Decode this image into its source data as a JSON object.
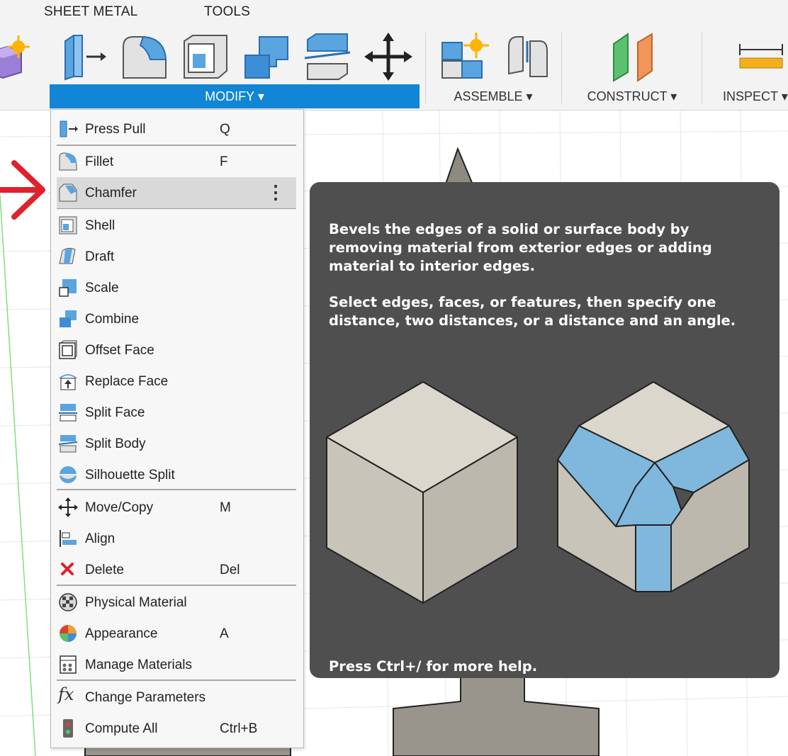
{
  "toolbar": {
    "tabs": [
      {
        "label": "SHEET METAL"
      },
      {
        "label": "TOOLS"
      }
    ],
    "sections": {
      "modify": "MODIFY ▾",
      "assemble": "ASSEMBLE ▾",
      "construct": "CONSTRUCT ▾",
      "inspect": "INSPECT ▾"
    },
    "icons": [
      "create-form-icon",
      "press-pull-icon",
      "fillet-icon",
      "shell-icon",
      "combine-icon",
      "split-body-icon",
      "move-icon",
      "new-component-icon",
      "joint-icon",
      "offset-plane-icon",
      "measure-icon"
    ],
    "accent": "#1185d6"
  },
  "menu": {
    "items": [
      {
        "label": "Press Pull",
        "shortcut": "Q",
        "icon": "press-pull-icon"
      },
      {
        "label": "Fillet",
        "shortcut": "F",
        "icon": "fillet-icon"
      },
      {
        "label": "Chamfer",
        "shortcut": "",
        "icon": "chamfer-icon",
        "highlighted": true
      },
      {
        "label": "Shell",
        "shortcut": "",
        "icon": "shell-icon"
      },
      {
        "label": "Draft",
        "shortcut": "",
        "icon": "draft-icon"
      },
      {
        "label": "Scale",
        "shortcut": "",
        "icon": "scale-icon"
      },
      {
        "label": "Combine",
        "shortcut": "",
        "icon": "combine-icon"
      },
      {
        "label": "Offset Face",
        "shortcut": "",
        "icon": "offset-face-icon"
      },
      {
        "label": "Replace Face",
        "shortcut": "",
        "icon": "replace-face-icon"
      },
      {
        "label": "Split Face",
        "shortcut": "",
        "icon": "split-face-icon"
      },
      {
        "label": "Split Body",
        "shortcut": "",
        "icon": "split-body-icon"
      },
      {
        "label": "Silhouette Split",
        "shortcut": "",
        "icon": "silhouette-split-icon"
      },
      {
        "label": "Move/Copy",
        "shortcut": "M",
        "icon": "move-copy-icon"
      },
      {
        "label": "Align",
        "shortcut": "",
        "icon": "align-icon"
      },
      {
        "label": "Delete",
        "shortcut": "Del",
        "icon": "delete-icon"
      },
      {
        "label": "Physical Material",
        "shortcut": "",
        "icon": "physical-material-icon"
      },
      {
        "label": "Appearance",
        "shortcut": "A",
        "icon": "appearance-icon"
      },
      {
        "label": "Manage Materials",
        "shortcut": "",
        "icon": "manage-materials-icon"
      },
      {
        "label": "Change Parameters",
        "shortcut": "",
        "icon": "change-parameters-icon"
      },
      {
        "label": "Compute All",
        "shortcut": "Ctrl+B",
        "icon": "compute-all-icon"
      }
    ]
  },
  "tooltip": {
    "p1": "Bevels the edges of a solid or surface body by removing material from exterior edges or adding material to interior edges.",
    "p2": "Select edges, faces, or features, then specify one distance, two distances, or a distance and an angle.",
    "footer": "Press Ctrl+/ for more help."
  }
}
